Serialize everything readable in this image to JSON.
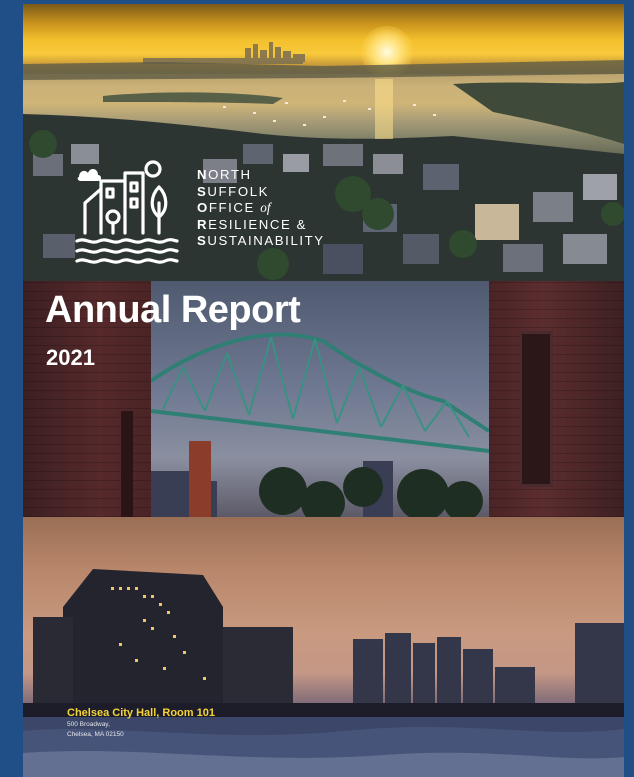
{
  "logo": {
    "line1": {
      "cap": "N",
      "rest": "ORTH"
    },
    "line2": {
      "cap": "S",
      "rest": "UFFOLK"
    },
    "line3": {
      "cap": "O",
      "rest": "FFICE ",
      "of": "of"
    },
    "line4": {
      "cap": "R",
      "rest": "ESILIENCE &"
    },
    "line5": {
      "cap": "S",
      "rest": "USTAINABILITY"
    },
    "icon": "buildings-waves-logo-icon"
  },
  "report": {
    "title": "Annual Report",
    "year": "2021"
  },
  "address": {
    "title": "Chelsea City Hall, Room 101",
    "street": "500 Broadway,",
    "city": "Chelsea, MA 02150"
  },
  "colors": {
    "background_blue": "#1f4f86",
    "address_yellow": "#f6d43a",
    "bridge_green": "#2f7f74",
    "brick_red": "#56292b"
  }
}
